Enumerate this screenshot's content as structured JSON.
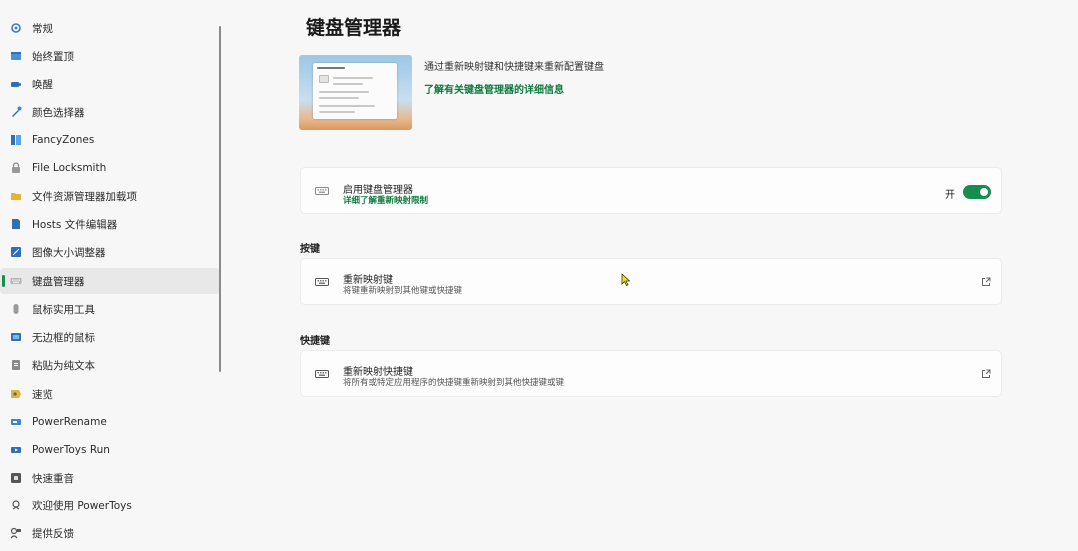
{
  "sidebar": {
    "items": [
      {
        "label": "常规",
        "icon": "gear-icon"
      },
      {
        "label": "始终置顶",
        "icon": "pin-window-icon"
      },
      {
        "label": "唤醒",
        "icon": "coffee-icon"
      },
      {
        "label": "颜色选择器",
        "icon": "color-picker-icon"
      },
      {
        "label": "FancyZones",
        "icon": "fancyzones-icon"
      },
      {
        "label": "File Locksmith",
        "icon": "lock-icon"
      },
      {
        "label": "文件资源管理器加载项",
        "icon": "folder-icon"
      },
      {
        "label": "Hosts 文件编辑器",
        "icon": "hosts-file-icon"
      },
      {
        "label": "图像大小调整器",
        "icon": "image-resize-icon"
      },
      {
        "label": "键盘管理器",
        "icon": "keyboard-icon",
        "selected": true
      },
      {
        "label": "鼠标实用工具",
        "icon": "mouse-icon"
      },
      {
        "label": "无边框的鼠标",
        "icon": "mouse-without-borders-icon"
      },
      {
        "label": "粘贴为纯文本",
        "icon": "paste-text-icon"
      },
      {
        "label": "速览",
        "icon": "peek-icon"
      },
      {
        "label": "PowerRename",
        "icon": "rename-icon"
      },
      {
        "label": "PowerToys Run",
        "icon": "run-icon"
      },
      {
        "label": "快速重音",
        "icon": "accent-icon"
      },
      {
        "label": "欢迎使用 PowerToys",
        "icon": "welcome-icon"
      },
      {
        "label": "提供反馈",
        "icon": "feedback-icon"
      }
    ]
  },
  "main": {
    "title": "键盘管理器",
    "hero": {
      "description": "通过重新映射键和快捷键来重新配置键盘",
      "link": "了解有关键盘管理器的详细信息"
    },
    "enable_card": {
      "title": "启用键盘管理器",
      "link": "详细了解重新映射限制",
      "toggle_label": "开",
      "toggle_on": true,
      "icon": "keyboard-icon"
    },
    "keys_section": {
      "header": "按键",
      "card_title": "重新映射键",
      "card_desc": "将键重新映射到其他键或快捷键",
      "icon": "keyboard-icon"
    },
    "shortcuts_section": {
      "header": "快捷键",
      "card_title": "重新映射快捷键",
      "card_desc": "将所有或特定应用程序的快捷键重新映射到其他快捷键或键",
      "icon": "keyboard-icon"
    }
  },
  "colors": {
    "accent": "#168e4d",
    "link": "#0f7a3e",
    "background": "#f7f7f7",
    "card": "#fdfdfd"
  }
}
